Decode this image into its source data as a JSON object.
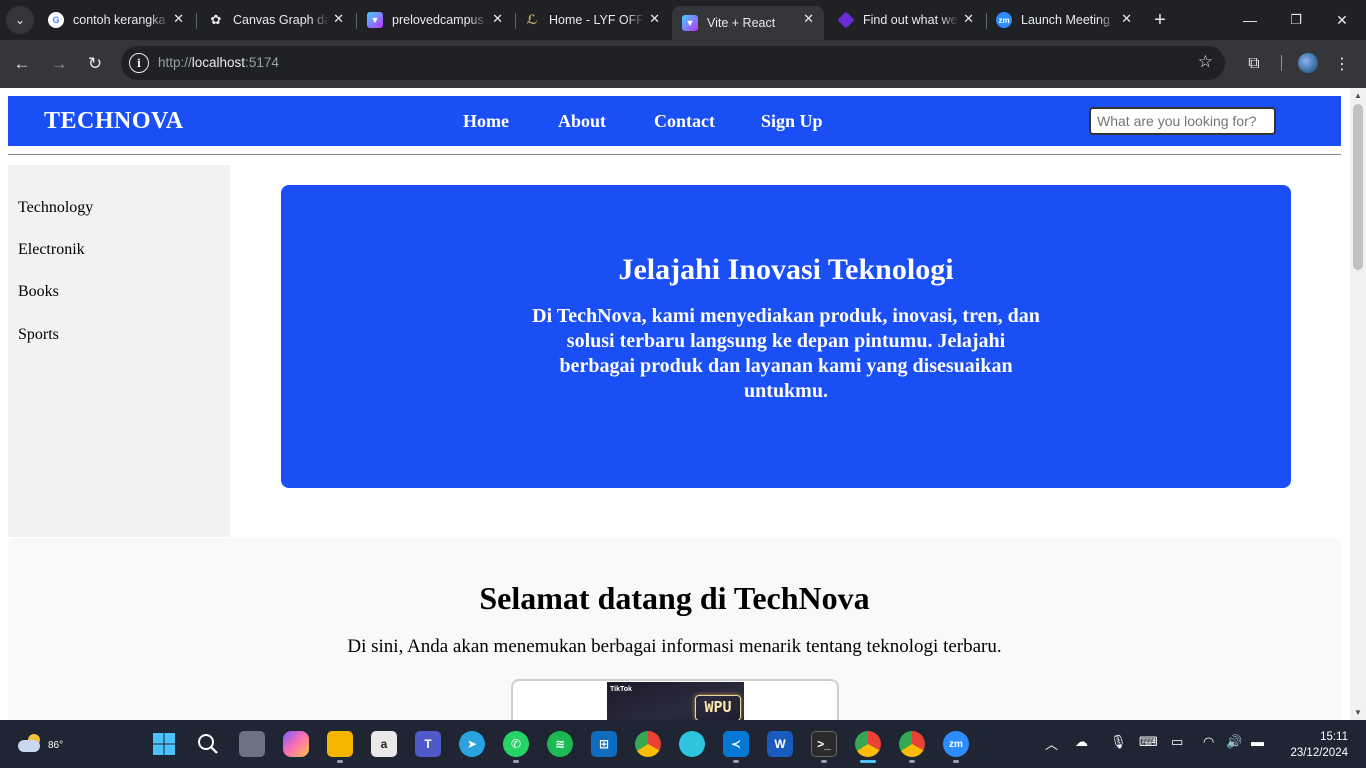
{
  "browser": {
    "tabs": [
      {
        "title": "contoh kerangka",
        "active": false
      },
      {
        "title": "Canvas Graph dan",
        "active": false
      },
      {
        "title": "prelovedcampus",
        "active": false
      },
      {
        "title": "Home - LYF OFFICIAL",
        "active": false
      },
      {
        "title": "Vite + React",
        "active": true
      },
      {
        "title": "Find out what we",
        "active": false
      },
      {
        "title": "Launch Meeting",
        "active": false
      }
    ],
    "url_prefix": "http://",
    "url_host": "localhost",
    "url_port": ":5174"
  },
  "page": {
    "brand": "TECHNOVA",
    "nav": [
      "Home",
      "About",
      "Contact",
      "Sign Up"
    ],
    "search_placeholder": "What are you looking for?",
    "sidebar": [
      "Technology",
      "Electronik",
      "Books",
      "Sports"
    ],
    "hero": {
      "title": "Jelajahi Inovasi Teknologi",
      "text": "Di TechNova, kami menyediakan produk, inovasi, tren, dan solusi terbaru langsung ke depan pintumu. Jelajahi berbagai produk dan layanan kami yang disesuaikan untukmu."
    },
    "welcome": {
      "title": "Selamat datang di TechNova",
      "text": "Di sini, Anda akan menemukan berbagai informasi menarik tentang teknologi terbaru."
    },
    "video": {
      "platform": "TikTok",
      "neon_text": "WPU"
    }
  },
  "taskbar": {
    "temperature": "86°",
    "time": "15:11",
    "date": "23/12/2024"
  },
  "colors": {
    "primary_blue": "#1a4ff5",
    "browser_dark": "#202124",
    "toolbar": "#35363a",
    "taskbar": "#1f2533"
  }
}
